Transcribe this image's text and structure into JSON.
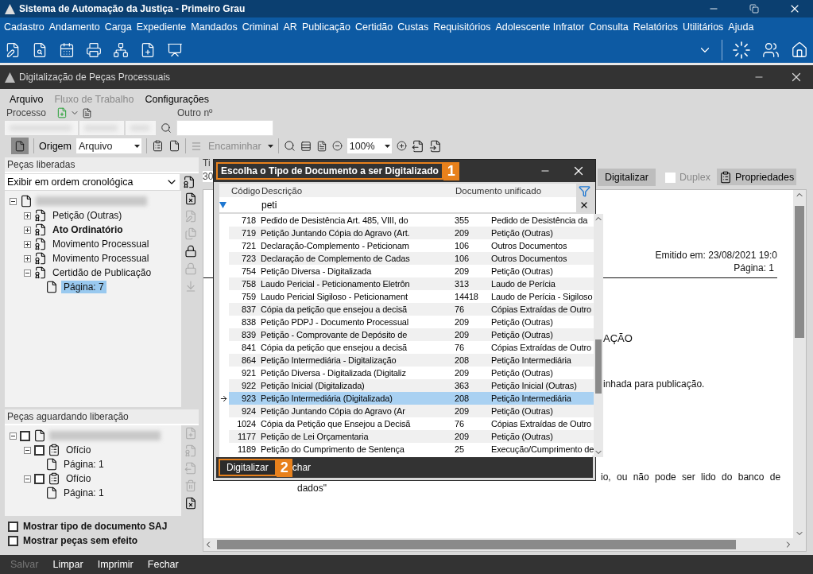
{
  "app": {
    "title": "Sistema de Automação da Justiça - Primeiro Grau"
  },
  "menu": [
    {
      "label": "Cadastro"
    },
    {
      "label": "Andamento"
    },
    {
      "label": "Carga"
    },
    {
      "label": "Expediente"
    },
    {
      "label": "Mandados"
    },
    {
      "label": "Criminal"
    },
    {
      "label": "AR"
    },
    {
      "label": "Publicação"
    },
    {
      "label": "Certidão"
    },
    {
      "label": "Custas"
    },
    {
      "label": "Requisitórios"
    },
    {
      "label": "Adolescente Infrator"
    },
    {
      "label": "Consulta"
    },
    {
      "label": "Relatórios"
    },
    {
      "label": "Utilitários"
    },
    {
      "label": "Ajuda"
    }
  ],
  "inner_window": {
    "title": "Digitalização de Peças Processuais"
  },
  "inner_menu": [
    {
      "label": "Arquivo",
      "disabled": false
    },
    {
      "label": "Fluxo de Trabalho",
      "disabled": true
    },
    {
      "label": "Configurações",
      "disabled": false
    }
  ],
  "process": {
    "label": "Processo",
    "other_label": "Outro nº"
  },
  "toolbar": {
    "origin_label": "Origem",
    "origin_value": "Arquivo",
    "forward_label": "Encaminhar",
    "forward_disabled": true,
    "zoom_value": "100%"
  },
  "released": {
    "title": "Peças liberadas",
    "order": "Exibir em ordem cronológica",
    "root": {
      "expanded": true,
      "children": [
        {
          "label": "Petição (Outras)",
          "bold": false,
          "expanded": false,
          "selected": false
        },
        {
          "label": "Ato Ordinatório",
          "bold": true,
          "expanded": false,
          "selected": false
        },
        {
          "label": "Movimento Processual",
          "bold": false,
          "expanded": false,
          "selected": false
        },
        {
          "label": "Movimento Processual",
          "bold": false,
          "expanded": false,
          "selected": false
        },
        {
          "label": "Certidão de Publicação",
          "bold": false,
          "expanded": true,
          "selected": false,
          "children": [
            {
              "label": "Página: 7",
              "selected": true
            }
          ]
        }
      ]
    }
  },
  "pending": {
    "title": "Peças aguardando liberação",
    "root": {
      "expanded": true,
      "checked": false,
      "children": [
        {
          "label": "Ofício",
          "expanded": true,
          "checked": false,
          "children": [
            {
              "label": "Página: 1"
            }
          ]
        },
        {
          "label": "Ofício",
          "expanded": true,
          "checked": false,
          "children": [
            {
              "label": "Página: 1"
            }
          ]
        }
      ]
    }
  },
  "options": [
    {
      "label": "Mostrar tipo de documento SAJ",
      "checked": false
    },
    {
      "label": "Mostrar peças sem efeito",
      "checked": false
    }
  ],
  "document_panel": {
    "type_label": "Ti",
    "type_value": "30",
    "scan_button": "Digitalizar",
    "duplex": {
      "label": "Duplex",
      "checked": false,
      "disabled": true
    },
    "properties_button": "Propriedades",
    "page": {
      "issued": "Emitido em: 23/08/2021 19:0",
      "page": "Página: 1",
      "heading": "AÇÃO",
      "line_1": "inhada para publicação.",
      "line_2": "io, ou não pode ser lido do banco de",
      "line_3": "dados\""
    }
  },
  "footer": [
    {
      "label": "Salvar",
      "disabled": true
    },
    {
      "label": "Limpar",
      "disabled": false
    },
    {
      "label": "Imprimir",
      "disabled": false
    },
    {
      "label": "Fechar",
      "disabled": false
    }
  ],
  "dialog": {
    "title": "Escolha o Tipo de Documento a ser Digitalizado",
    "title_step": "1",
    "columns": [
      "Código",
      "Descrição",
      "Documento unificado"
    ],
    "filter": "peti",
    "rows": [
      {
        "code": "718",
        "description": "Pedido de Desistência Art. 485, VIII, do",
        "unified_code": "355",
        "unified": "Pedido de Desistência da",
        "selected": false
      },
      {
        "code": "719",
        "description": "Petição Juntando Cópia do Agravo (Art.",
        "unified_code": "209",
        "unified": "Petição (Outras)",
        "selected": false
      },
      {
        "code": "721",
        "description": "Declaração-Complemento - Peticionam",
        "unified_code": "106",
        "unified": "Outros Documentos",
        "selected": false
      },
      {
        "code": "723",
        "description": "Declaração de Complemento de Cadas",
        "unified_code": "106",
        "unified": "Outros Documentos",
        "selected": false
      },
      {
        "code": "754",
        "description": "Petição Diversa - Digitalizada",
        "unified_code": "209",
        "unified": "Petição (Outras)",
        "selected": false
      },
      {
        "code": "758",
        "description": "Laudo Pericial - Peticionamento Eletrôn",
        "unified_code": "313",
        "unified": "Laudo de Perícia",
        "selected": false
      },
      {
        "code": "759",
        "description": "Laudo Pericial Sigiloso - Peticionament",
        "unified_code": "14418",
        "unified": "Laudo de Perícia - Sigiloso",
        "selected": false
      },
      {
        "code": "837",
        "description": "Cópia da petição que ensejou a decisã",
        "unified_code": "76",
        "unified": "Cópias Extraídas de Outro",
        "selected": false
      },
      {
        "code": "838",
        "description": "Petição PDPJ - Documento Processual",
        "unified_code": "209",
        "unified": "Petição (Outras)",
        "selected": false
      },
      {
        "code": "839",
        "description": "Petição - Comprovante de Depósito de",
        "unified_code": "209",
        "unified": "Petição (Outras)",
        "selected": false
      },
      {
        "code": "841",
        "description": "Cópia da petição que ensejou a decisã",
        "unified_code": "76",
        "unified": "Cópias Extraídas de Outro",
        "selected": false
      },
      {
        "code": "864",
        "description": "Petição Intermediária - Digitalização",
        "unified_code": "208",
        "unified": "Petição Intermediária",
        "selected": false
      },
      {
        "code": "921",
        "description": "Petição Diversa - Digitalizada (Digitaliz",
        "unified_code": "209",
        "unified": "Petição (Outras)",
        "selected": false
      },
      {
        "code": "922",
        "description": "Petição Inicial (Digitalizada)",
        "unified_code": "363",
        "unified": "Petição Inicial (Outras)",
        "selected": false
      },
      {
        "code": "923",
        "description": "Petição Intermediária (Digitalizada)",
        "unified_code": "208",
        "unified": "Petição Intermediária",
        "selected": true
      },
      {
        "code": "924",
        "description": "Petição Juntando Cópia do Agravo  (Ar",
        "unified_code": "209",
        "unified": "Petição (Outras)",
        "selected": false
      },
      {
        "code": "1024",
        "description": "Cópia da Petição que Ensejou a Decisã",
        "unified_code": "76",
        "unified": "Cópias Extraídas de Outro",
        "selected": false
      },
      {
        "code": "1177",
        "description": "Petição de Lei Orçamentaria",
        "unified_code": "209",
        "unified": "Petição (Outras)",
        "selected": false
      },
      {
        "code": "1189",
        "description": "Petição do Cumprimento de Sentença",
        "unified_code": "25",
        "unified": "Execução/Cumprimento de",
        "selected": false
      }
    ],
    "scan_button": "Digitalizar",
    "scan_step": "2",
    "close_button": "char"
  }
}
